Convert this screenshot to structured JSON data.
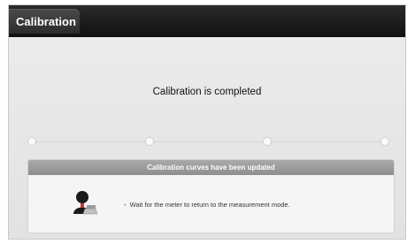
{
  "window": {
    "title": "Calibration"
  },
  "status": {
    "message": "Calibration is completed"
  },
  "progress": {
    "steps_completed": 4,
    "steps_total": 4
  },
  "panel": {
    "header": "Calibration curves have been updated",
    "note": "Wait for the meter to return to the measurement mode.",
    "bullet": "•",
    "icon": "user-at-computer-icon"
  },
  "colors": {
    "titlebar": "#111111",
    "panel_header": "#9a9a9a",
    "background": "#e6e6e6"
  }
}
